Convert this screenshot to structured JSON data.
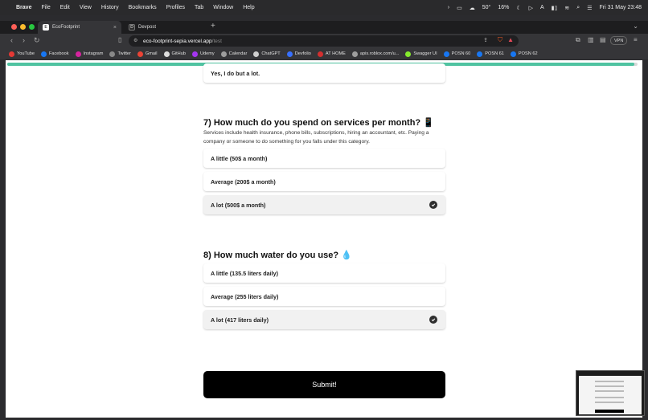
{
  "menubar": {
    "app": "Brave",
    "items": [
      "File",
      "Edit",
      "View",
      "History",
      "Bookmarks",
      "Profiles",
      "Tab",
      "Window",
      "Help"
    ],
    "status": {
      "temp": "50°",
      "battery": "16%",
      "datetime": "Fri 31 May  23:48"
    }
  },
  "tabs": [
    {
      "label": "EcoFootprint",
      "active": true
    },
    {
      "label": "Devpost",
      "active": false
    }
  ],
  "address": {
    "host": "eco-footprint-sepia.vercel.app",
    "path": "/test"
  },
  "vpn_label": "VPN",
  "bookmarks": [
    {
      "label": "YouTube",
      "color": "#e53935"
    },
    {
      "label": "Facebook",
      "color": "#1877f2"
    },
    {
      "label": "Instagram",
      "color": "#d6249f"
    },
    {
      "label": "Twitter",
      "color": "#888888"
    },
    {
      "label": "Gmail",
      "color": "#ea4335"
    },
    {
      "label": "GitHub",
      "color": "#dddddd"
    },
    {
      "label": "Udemy",
      "color": "#a435f0"
    },
    {
      "label": "Calendar",
      "color": "#9e9e9e"
    },
    {
      "label": "ChatGPT",
      "color": "#cfcfcf"
    },
    {
      "label": "Devfolio",
      "color": "#3770ff"
    },
    {
      "label": "AT HOME",
      "color": "#d32f2f"
    },
    {
      "label": "apis.roblox.com/u...",
      "color": "#9e9e9e"
    },
    {
      "label": "Swagger UI",
      "color": "#85ea2d"
    },
    {
      "label": "POSN 60",
      "color": "#1877f2"
    },
    {
      "label": "POSN 61",
      "color": "#1877f2"
    },
    {
      "label": "POSN 62",
      "color": "#1877f2"
    }
  ],
  "progress": {
    "percent": 99.5,
    "color": "#4fc3a1"
  },
  "prev_option": {
    "label": "Yes, I do but a lot."
  },
  "q7": {
    "title": "7) How much do you spend on services per month? 📱",
    "description": "Services include health insurance, phone bills, subscriptions, hiring an accountant, etc. Paying a company or someone to do something for you falls under this category.",
    "options": [
      {
        "label": "A little (50$ a month)",
        "selected": false
      },
      {
        "label": "Average (200$ a month)",
        "selected": false
      },
      {
        "label": "A lot (500$ a month)",
        "selected": true
      }
    ]
  },
  "q8": {
    "title": "8) How much water do you use? 💧",
    "options": [
      {
        "label": "A little (135.5 liters daily)",
        "selected": false
      },
      {
        "label": "Average (255 liters daily)",
        "selected": false
      },
      {
        "label": "A lot (417 liters daily)",
        "selected": true
      }
    ]
  },
  "submit_label": "Submit!"
}
